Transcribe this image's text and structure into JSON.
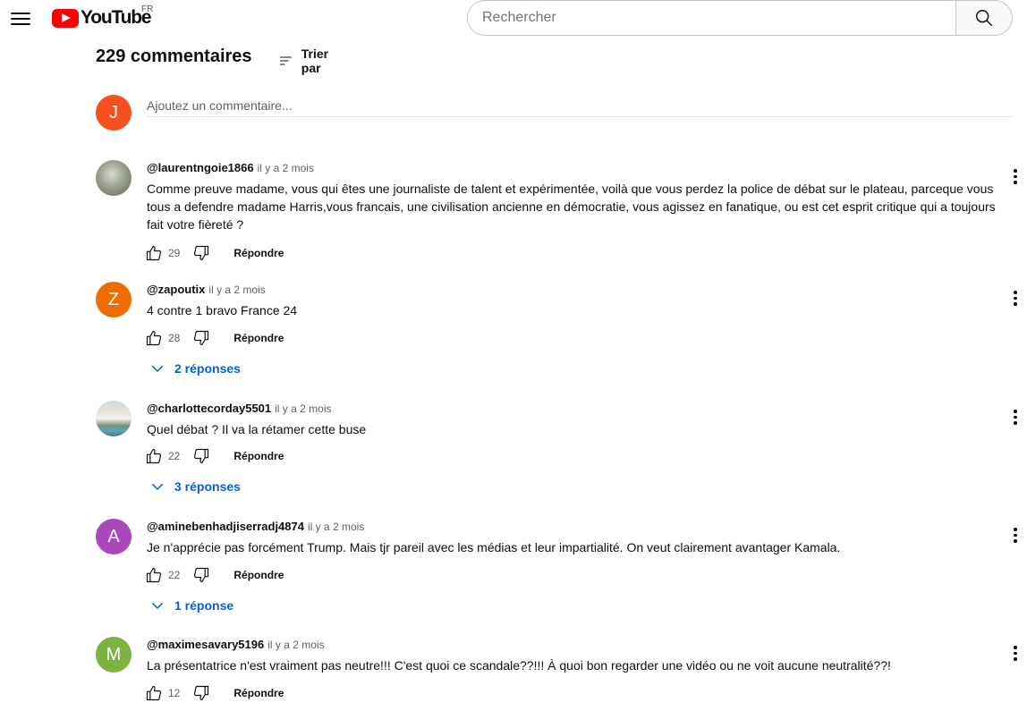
{
  "header": {
    "logo_text": "YouTube",
    "country_code": "FR",
    "search_placeholder": "Rechercher"
  },
  "comments_header": {
    "count_label": "229 commentaires",
    "sort_label": "Trier par",
    "add_avatar_letter": "J",
    "add_placeholder": "Ajoutez un commentaire..."
  },
  "comments": [
    {
      "author": "@laurentngoie1866",
      "time": "il y a 2 mois",
      "text": "Comme preuve madame, vous qui êtes une journaliste de talent et expérimentée, voilà que vous perdez la police de débat sur le plateau, parceque vous tous a defendre madame Harris,vous francais, une civilisation ancienne en démocratie, vous agissez en fanatique, ou est cet esprit critique qui a toujours fait votre fièreté ?",
      "likes": "29",
      "reply_label": "Répondre"
    },
    {
      "author": "@zapoutix",
      "time": "il y a 2 mois",
      "avatar_letter": "Z",
      "text": "4 contre 1 bravo France 24",
      "likes": "28",
      "reply_label": "Répondre",
      "replies_label": "2 réponses"
    },
    {
      "author": "@charlottecorday5501",
      "time": "il y a 2 mois",
      "text": "Quel débat ? Il va la rétamer cette buse",
      "likes": "22",
      "reply_label": "Répondre",
      "replies_label": "3 réponses"
    },
    {
      "author": "@aminebenhadjiserradj4874",
      "time": "il y a 2 mois",
      "avatar_letter": "A",
      "text": "Je n'apprécie pas forcément Trump. Mais tjr pareil avec les médias et leur impartialité. On veut clairement avantager Kamala.",
      "likes": "22",
      "reply_label": "Répondre",
      "replies_label": "1 réponse"
    },
    {
      "author": "@maximesavary5196",
      "time": "il y a 2 mois",
      "avatar_letter": "M",
      "text": "La présentatrice n'est vraiment pas neutre!!! C'est quoi ce scandale??!!! À quoi bon regarder une vidéo ou ne voit aucune neutralité??!",
      "likes": "12",
      "reply_label": "Répondre"
    }
  ],
  "colors": {
    "brand_red": "#ff0000",
    "link_blue": "#065fd4",
    "avatar_j": "#f4511e",
    "avatar_z": "#ef6c00",
    "avatar_a": "#ab47bc",
    "avatar_m": "#7cb342"
  }
}
